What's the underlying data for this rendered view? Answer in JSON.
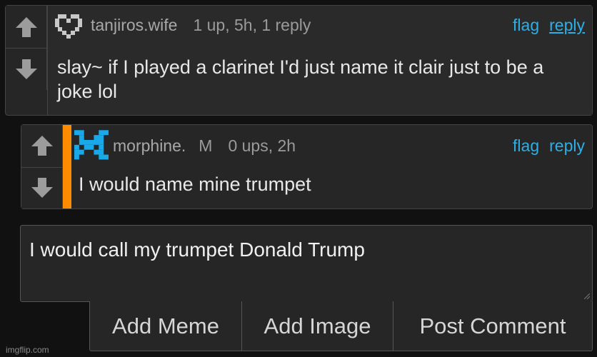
{
  "comments": [
    {
      "username": "tanjiros.wife",
      "badge": "",
      "stats": "1 up, 5h, 1 reply",
      "flag_label": "flag",
      "reply_label": "reply",
      "text": "slay~ if I played a clarinet I'd just name it clair just to be a joke lol"
    },
    {
      "username": "morphine.",
      "badge": "M",
      "stats": "0 ups, 2h",
      "flag_label": "flag",
      "reply_label": "reply",
      "text": "I would name mine trumpet"
    }
  ],
  "composer": {
    "value": "I would call my trumpet Donald Trump"
  },
  "buttons": {
    "add_meme": "Add Meme",
    "add_image": "Add Image",
    "post_comment": "Post Comment"
  },
  "watermark": "imgflip.com",
  "colors": {
    "background": "#111111",
    "panel": "#262626",
    "link": "#2dafe6",
    "op_marker": "#ff8c00",
    "avatar2": "#19a8e8"
  },
  "icons": {
    "upvote": "upvote-arrow-icon",
    "downvote": "downvote-arrow-icon"
  }
}
